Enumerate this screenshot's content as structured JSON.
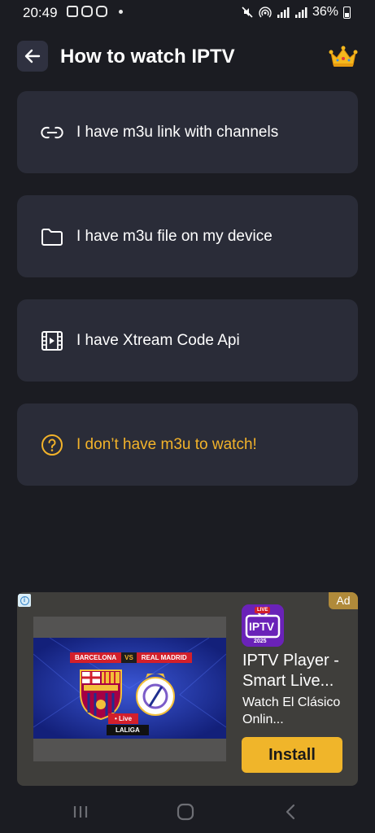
{
  "status_bar": {
    "time": "20:49",
    "battery": "36%",
    "icons": [
      "gallery-icon",
      "instagram-icon",
      "instagram-icon",
      "mute-icon",
      "hotspot-icon",
      "signal-icon",
      "signal-icon",
      "battery-icon"
    ]
  },
  "header": {
    "title": "How to watch IPTV",
    "back_icon": "arrow-left-icon",
    "premium_icon": "crown-icon"
  },
  "options": [
    {
      "label": "I have m3u link with channels",
      "icon": "link-icon"
    },
    {
      "label": "I have m3u file on my device",
      "icon": "folder-icon"
    },
    {
      "label": "I have Xtream Code Api",
      "icon": "video-file-icon"
    },
    {
      "label": "I don’t have m3u to watch!",
      "icon": "help-icon"
    }
  ],
  "ad": {
    "badge": "Ad",
    "app_name": "IPTV Player - Smart Live...",
    "description": "Watch El Clásico Onlin...",
    "install_label": "Install",
    "app_icon_text": "IPTV",
    "app_icon_live": "LIVE",
    "app_icon_year": "2025",
    "banner": {
      "team_left": "BARCELONA",
      "vs": "VS",
      "team_right": "REAL MADRID",
      "live": "• Live",
      "league": "LALIGA"
    }
  },
  "colors": {
    "background": "#1b1c22",
    "card": "#2a2c38",
    "accent": "#f3b32a",
    "install": "#f0b52a"
  },
  "nav_bar": {
    "buttons": [
      "recents-icon",
      "home-icon",
      "back-nav-icon"
    ]
  }
}
